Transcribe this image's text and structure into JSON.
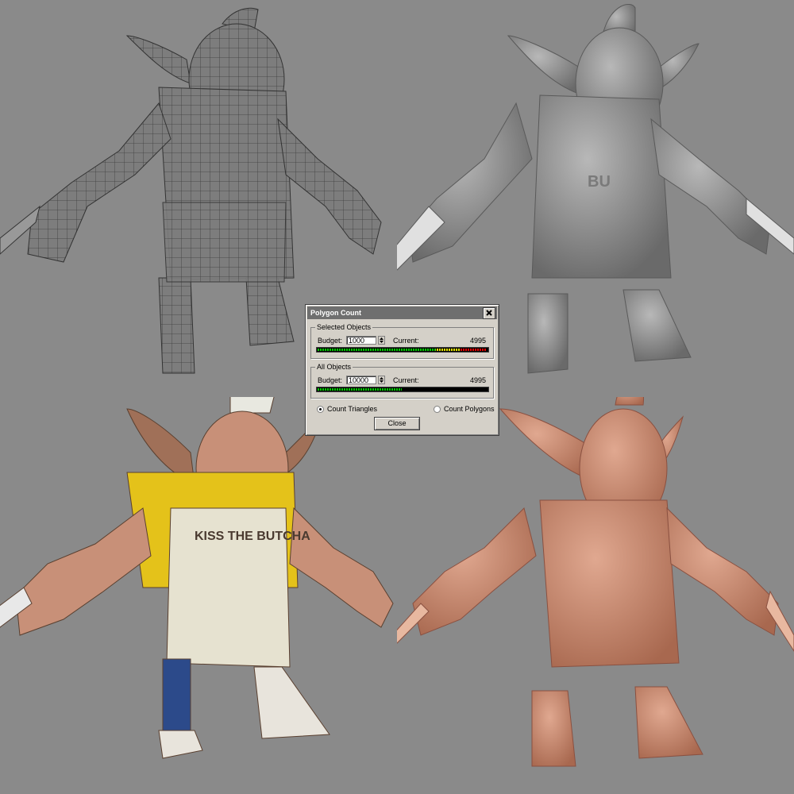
{
  "scene": {
    "background": "#8a8a8a",
    "views": [
      {
        "name": "wireframe",
        "color": "#7d7d7d"
      },
      {
        "name": "sculpt-gray",
        "color": "#8f8f8f"
      },
      {
        "name": "textured",
        "shirt_color": "#e4c21a",
        "skin_color": "#c89078",
        "apron_color": "#e6e2d0"
      },
      {
        "name": "clay-render",
        "color": "#c9876f"
      }
    ],
    "apron_text": "KISS THE BUTCHA",
    "apron_text_sculpt": "BU"
  },
  "dialog": {
    "title": "Polygon Count",
    "selected_objects": {
      "legend": "Selected Objects",
      "budget_label": "Budget:",
      "budget_value": "1000",
      "current_label": "Current:",
      "current_value": "4995",
      "bar_level": 1.0,
      "bar_colors": [
        "#00c800",
        "#e0e000",
        "#e00000"
      ]
    },
    "all_objects": {
      "legend": "All Objects",
      "budget_label": "Budget:",
      "budget_value": "10000",
      "current_label": "Current:",
      "current_value": "4995",
      "bar_level": 0.4995,
      "bar_colors": [
        "#00c800"
      ]
    },
    "options": {
      "count_triangles": "Count Triangles",
      "count_polygons": "Count Polygons",
      "selected": "count_triangles"
    },
    "close_label": "Close"
  }
}
